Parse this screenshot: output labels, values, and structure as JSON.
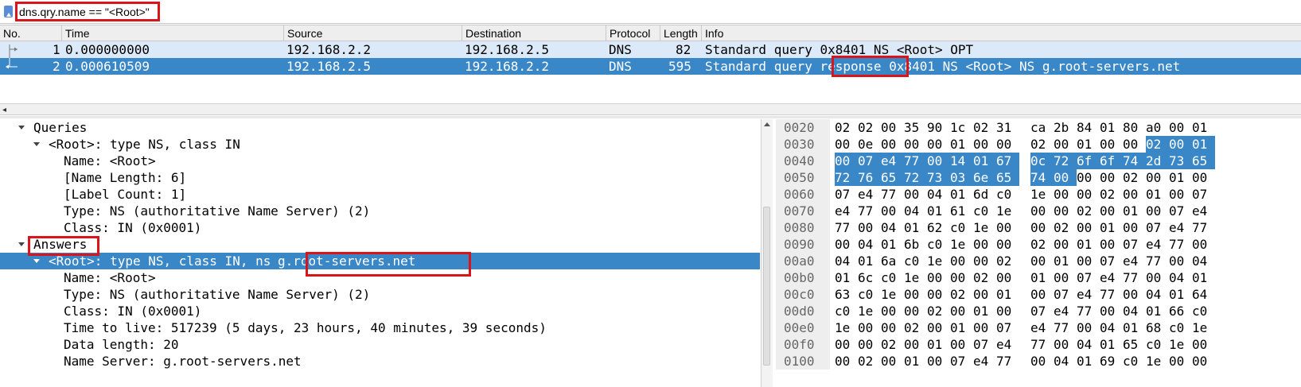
{
  "filter": {
    "text": "dns.qry.name == \"<Root>\""
  },
  "packet_list": {
    "columns": [
      "No.",
      "Time",
      "Source",
      "Destination",
      "Protocol",
      "Length",
      "Info"
    ],
    "rows": [
      {
        "no": "1",
        "time": "0.000000000",
        "source": "192.168.2.2",
        "destination": "192.168.2.5",
        "protocol": "DNS",
        "length": "82",
        "info_a": "Standard query ",
        "info_b": "0x8401 NS <Root> OPT",
        "info_c": ""
      },
      {
        "no": "2",
        "time": "0.000610509",
        "source": "192.168.2.5",
        "destination": "192.168.2.2",
        "protocol": "DNS",
        "length": "595",
        "info_a": "Standard query ",
        "info_b": "response",
        "info_c": " 0x8401 NS <Root> NS g.root-servers.net"
      }
    ]
  },
  "details": {
    "lines": [
      {
        "text": "Queries",
        "arrow": true
      },
      {
        "text": "<Root>: type NS, class IN",
        "arrow": true
      },
      {
        "text": "Name: <Root>",
        "arrow": false
      },
      {
        "text": "[Name Length: 6]",
        "arrow": false
      },
      {
        "text": "[Label Count: 1]",
        "arrow": false
      },
      {
        "text": "Type: NS (authoritative Name Server) (2)",
        "arrow": false
      },
      {
        "text": "Class: IN (0x0001)",
        "arrow": false
      },
      {
        "text": "Answers",
        "arrow": true
      },
      {
        "text": "<Root>: type NS, class IN, ns ",
        "text2": "g.root-servers.net",
        "arrow": true,
        "selected": true
      },
      {
        "text": "Name: <Root>",
        "arrow": false
      },
      {
        "text": "Type: NS (authoritative Name Server) (2)",
        "arrow": false
      },
      {
        "text": "Class: IN (0x0001)",
        "arrow": false
      },
      {
        "text": "Time to live: 517239 (5 days, 23 hours, 40 minutes, 39 seconds)",
        "arrow": false
      },
      {
        "text": "Data length: 20",
        "arrow": false
      },
      {
        "text": "Name Server: g.root-servers.net",
        "arrow": false
      }
    ]
  },
  "hex": {
    "rows": [
      {
        "offset": "0020",
        "bytes": [
          "02",
          "02",
          "00",
          "35",
          "90",
          "1c",
          "02",
          "31",
          "ca",
          "2b",
          "84",
          "01",
          "80",
          "a0",
          "00",
          "01"
        ]
      },
      {
        "offset": "0030",
        "bytes": [
          "00",
          "0e",
          "00",
          "00",
          "00",
          "01",
          "00",
          "00",
          "02",
          "00",
          "01",
          "00",
          "00",
          "02",
          "00",
          "01"
        ]
      },
      {
        "offset": "0040",
        "bytes": [
          "00",
          "07",
          "e4",
          "77",
          "00",
          "14",
          "01",
          "67",
          "0c",
          "72",
          "6f",
          "6f",
          "74",
          "2d",
          "73",
          "65"
        ]
      },
      {
        "offset": "0050",
        "bytes": [
          "72",
          "76",
          "65",
          "72",
          "73",
          "03",
          "6e",
          "65",
          "74",
          "00",
          "00",
          "00",
          "02",
          "00",
          "01",
          "00"
        ]
      },
      {
        "offset": "0060",
        "bytes": [
          "07",
          "e4",
          "77",
          "00",
          "04",
          "01",
          "6d",
          "c0",
          "1e",
          "00",
          "00",
          "02",
          "00",
          "01",
          "00",
          "07"
        ]
      },
      {
        "offset": "0070",
        "bytes": [
          "e4",
          "77",
          "00",
          "04",
          "01",
          "61",
          "c0",
          "1e",
          "00",
          "00",
          "02",
          "00",
          "01",
          "00",
          "07",
          "e4"
        ]
      },
      {
        "offset": "0080",
        "bytes": [
          "77",
          "00",
          "04",
          "01",
          "62",
          "c0",
          "1e",
          "00",
          "00",
          "02",
          "00",
          "01",
          "00",
          "07",
          "e4",
          "77"
        ]
      },
      {
        "offset": "0090",
        "bytes": [
          "00",
          "04",
          "01",
          "6b",
          "c0",
          "1e",
          "00",
          "00",
          "02",
          "00",
          "01",
          "00",
          "07",
          "e4",
          "77",
          "00"
        ]
      },
      {
        "offset": "00a0",
        "bytes": [
          "04",
          "01",
          "6a",
          "c0",
          "1e",
          "00",
          "00",
          "02",
          "00",
          "01",
          "00",
          "07",
          "e4",
          "77",
          "00",
          "04"
        ]
      },
      {
        "offset": "00b0",
        "bytes": [
          "01",
          "6c",
          "c0",
          "1e",
          "00",
          "00",
          "02",
          "00",
          "01",
          "00",
          "07",
          "e4",
          "77",
          "00",
          "04",
          "01"
        ]
      },
      {
        "offset": "00c0",
        "bytes": [
          "63",
          "c0",
          "1e",
          "00",
          "00",
          "02",
          "00",
          "01",
          "00",
          "07",
          "e4",
          "77",
          "00",
          "04",
          "01",
          "64"
        ]
      },
      {
        "offset": "00d0",
        "bytes": [
          "c0",
          "1e",
          "00",
          "00",
          "02",
          "00",
          "01",
          "00",
          "07",
          "e4",
          "77",
          "00",
          "04",
          "01",
          "66",
          "c0"
        ]
      },
      {
        "offset": "00e0",
        "bytes": [
          "1e",
          "00",
          "00",
          "02",
          "00",
          "01",
          "00",
          "07",
          "e4",
          "77",
          "00",
          "04",
          "01",
          "68",
          "c0",
          "1e"
        ]
      },
      {
        "offset": "00f0",
        "bytes": [
          "00",
          "00",
          "02",
          "00",
          "01",
          "00",
          "07",
          "e4",
          "77",
          "00",
          "04",
          "01",
          "65",
          "c0",
          "1e",
          "00"
        ]
      },
      {
        "offset": "0100",
        "bytes": [
          "00",
          "02",
          "00",
          "01",
          "00",
          "07",
          "e4",
          "77",
          "00",
          "04",
          "01",
          "69",
          "c0",
          "1e",
          "00",
          "00"
        ]
      }
    ]
  },
  "colors": {
    "selection": "#3a87c8",
    "row_light": "#dbe9f8",
    "annotation": "#d9141b"
  }
}
